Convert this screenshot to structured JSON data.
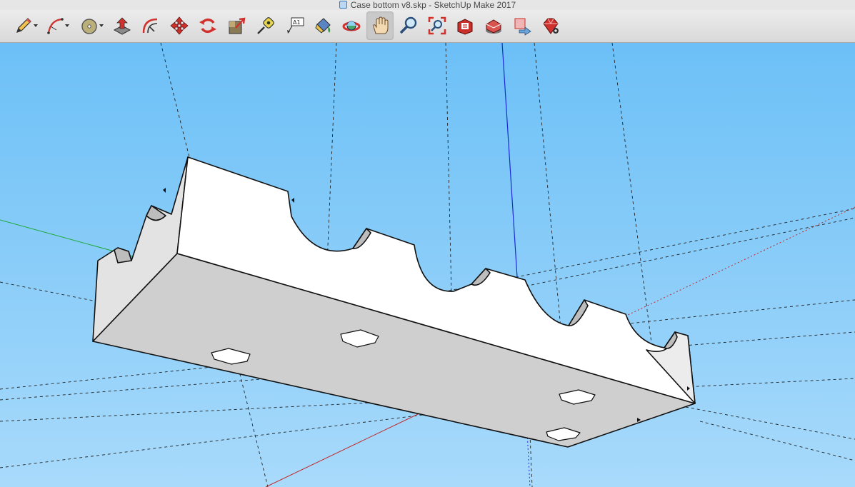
{
  "window": {
    "title": "Case bottom v8.skp - SketchUp Make 2017"
  },
  "toolbar": {
    "tools": [
      {
        "name": "pencil-tool",
        "icon": "pencil-icon",
        "has_dropdown": true
      },
      {
        "name": "arc-tool",
        "icon": "arc-icon",
        "has_dropdown": true
      },
      {
        "name": "circle-tool",
        "icon": "circle-icon",
        "has_dropdown": true
      },
      {
        "name": "push-pull-tool",
        "icon": "push-pull-icon"
      },
      {
        "name": "offset-tool",
        "icon": "offset-icon"
      },
      {
        "name": "move-tool",
        "icon": "move-icon"
      },
      {
        "name": "rotate-tool",
        "icon": "rotate-icon"
      },
      {
        "name": "scale-tool",
        "icon": "scale-icon"
      },
      {
        "name": "tape-measure-tool",
        "icon": "tape-measure-icon"
      },
      {
        "name": "text-tool",
        "icon": "text-icon",
        "label": "A1"
      },
      {
        "name": "paint-bucket-tool",
        "icon": "paint-bucket-icon"
      },
      {
        "name": "orbit-tool",
        "icon": "orbit-icon"
      },
      {
        "name": "pan-tool",
        "icon": "hand-icon",
        "active": true
      },
      {
        "name": "zoom-tool",
        "icon": "zoom-icon"
      },
      {
        "name": "zoom-extents-tool",
        "icon": "zoom-extents-icon"
      },
      {
        "name": "3d-warehouse-tool",
        "icon": "warehouse-icon"
      },
      {
        "name": "share-model-tool",
        "icon": "share-model-icon"
      },
      {
        "name": "share-component-tool",
        "icon": "share-component-icon"
      },
      {
        "name": "extension-warehouse-tool",
        "icon": "extension-warehouse-icon"
      }
    ]
  },
  "viewport": {
    "sky_top": "#6cc0f7",
    "sky_bottom": "#a8dafb",
    "axis_colors": {
      "x": "#c0282a",
      "y": "#1fa83a",
      "z": "#1a2ad6"
    },
    "model_colors": {
      "top_face": "#ffffff",
      "front_face": "#cfcfcf",
      "end_face": "#e3e3e3",
      "edge": "#111111"
    }
  }
}
